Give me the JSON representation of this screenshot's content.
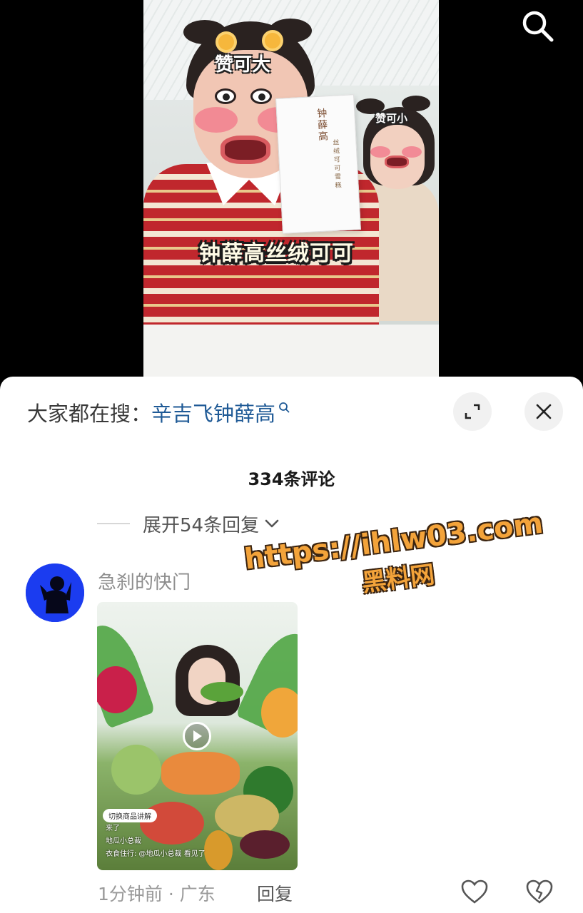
{
  "video": {
    "sticker_big": "赞可大",
    "sticker_small": "赞可小",
    "caption": "钟薛高丝绒可可",
    "product_pack_title": "钟薛高",
    "product_pack_subtitle": "丝绒可可雪糕"
  },
  "top_bar": {
    "search_icon": "search-icon"
  },
  "sheet": {
    "trending_prefix": "大家都在搜：",
    "trending_query": "辛吉飞钟薛高",
    "expand_icon": "expand-icon",
    "close_icon": "close-icon",
    "comment_count": "334条评论",
    "expand_replies_label": "展开54条回复"
  },
  "comment": {
    "username": "急刹的快门",
    "attached_video": {
      "switch_label": "切换商品讲解",
      "live_lines": [
        "来了",
        "地瓜小总裁",
        "衣食住行: @地瓜小总裁 看见了"
      ]
    },
    "time_location": "1分钟前 · 广东",
    "reply_label": "回复"
  },
  "watermark": {
    "url": "https://ihlw03.com",
    "name": "黑料网"
  },
  "colors": {
    "link_blue": "#1f5a96",
    "sheet_bg": "#ffffff",
    "watermark_orange": "#f3a33a"
  }
}
